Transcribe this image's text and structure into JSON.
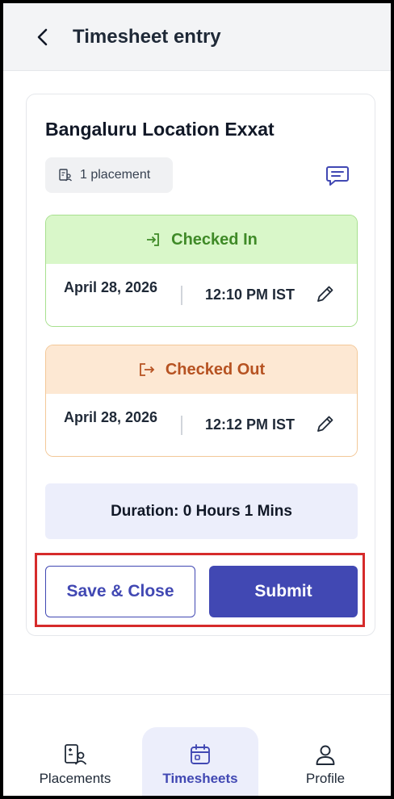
{
  "header": {
    "title": "Timesheet entry",
    "back_icon": "chevron-left-icon"
  },
  "card": {
    "location_title": "Bangaluru Location Exxat",
    "placement_chip": {
      "label": "1 placement",
      "icon": "placement-icon"
    },
    "chat_icon": "message-icon",
    "checked_in": {
      "label": "Checked In",
      "icon": "login-icon",
      "date": "April 28, 2026",
      "time": "12:10 PM IST",
      "edit_icon": "pencil-icon"
    },
    "checked_out": {
      "label": "Checked Out",
      "icon": "logout-icon",
      "date": "April 28, 2026",
      "time": "12:12 PM IST",
      "edit_icon": "pencil-icon"
    },
    "duration": "Duration: 0 Hours 1 Mins",
    "buttons": {
      "save_close": "Save & Close",
      "submit": "Submit"
    }
  },
  "bottom_nav": {
    "items": [
      {
        "label": "Placements",
        "icon": "placements-icon",
        "active": false
      },
      {
        "label": "Timesheets",
        "icon": "calendar-icon",
        "active": true
      },
      {
        "label": "Profile",
        "icon": "user-icon",
        "active": false
      }
    ]
  },
  "colors": {
    "accent": "#4148b3",
    "checked_in_bg": "#d9f7c9",
    "checked_in_text": "#3f8a27",
    "checked_out_bg": "#fde8d3",
    "checked_out_text": "#b65221",
    "highlight": "#d62b2b"
  }
}
